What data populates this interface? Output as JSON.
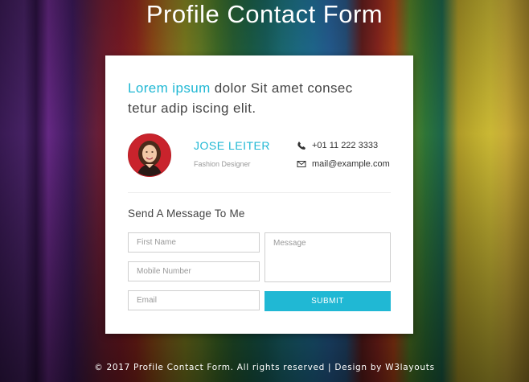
{
  "page": {
    "title": "Profile Contact Form"
  },
  "card": {
    "headline_accent": "Lorem ipsum",
    "headline_line1_rest": " dolor Sit amet consec",
    "headline_line2": "tetur adip iscing elit.",
    "profile": {
      "name": "JOSE LEITER",
      "role": "Fashion Designer",
      "phone": "+01 11 222 3333",
      "email": "mail@example.com",
      "phone_icon": "phone-icon",
      "email_icon": "envelope-icon"
    },
    "form": {
      "title": "Send A Message To Me",
      "first_name_placeholder": "First Name",
      "mobile_placeholder": "Mobile Number",
      "email_placeholder": "Email",
      "message_placeholder": "Message",
      "submit_label": "SUBMIT"
    }
  },
  "footer": {
    "text": "© 2017 Profile Contact Form. All rights reserved | Design by ",
    "brand": "W3layouts"
  },
  "colors": {
    "accent": "#20b8d4",
    "avatar_bg": "#c9232c"
  }
}
